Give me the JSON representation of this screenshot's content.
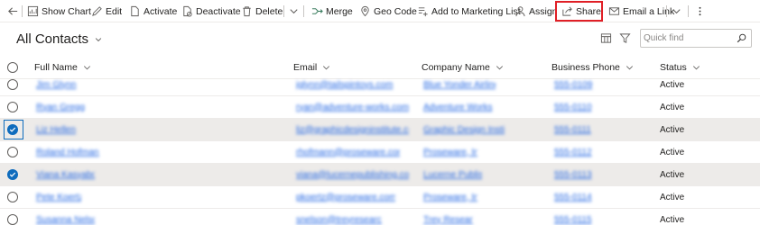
{
  "toolbar": {
    "show_chart": "Show Chart",
    "edit": "Edit",
    "activate": "Activate",
    "deactivate": "Deactivate",
    "delete": "Delete",
    "merge": "Merge",
    "geo_code": "Geo Code",
    "add_to_marketing_list": "Add to Marketing List",
    "assign": "Assign",
    "share": "Share",
    "email_a_link": "Email a Link",
    "highlight_color": "#e01f26"
  },
  "view": {
    "title": "All Contacts",
    "quick_find_placeholder": "Quick find"
  },
  "columns": {
    "full_name": "Full Name",
    "email": "Email",
    "company_name": "Company Name",
    "business_phone": "Business Phone",
    "status": "Status"
  },
  "rows": [
    {
      "name": "Jim Glynn",
      "email": "jglynn@tailspintoys.com",
      "company": "Blue Yonder Airlines",
      "phone": "555-0109",
      "status": "Active",
      "selected": false
    },
    {
      "name": "Ryan Gregg",
      "email": "ryan@adventure-works.com",
      "company": "Adventure Works",
      "phone": "555-0110",
      "status": "Active",
      "selected": false
    },
    {
      "name": "Liz Hellen",
      "email": "liz@graphicdesigninstitute.com",
      "company": "Graphic Design Institute",
      "phone": "555-0111",
      "status": "Active",
      "selected": true
    },
    {
      "name": "Roland Hofmann",
      "email": "rhofmann@proseware.com",
      "company": "Proseware, Inc.",
      "phone": "555-0112",
      "status": "Active",
      "selected": false
    },
    {
      "name": "Viana Kasyabova",
      "email": "viana@lucernepublishing.com",
      "company": "Lucerne Publishing",
      "phone": "555-0113",
      "status": "Active",
      "selected": true
    },
    {
      "name": "Pete Koertz",
      "email": "pkoertz@proseware.com",
      "company": "Proseware, Inc.",
      "phone": "555-0114",
      "status": "Active",
      "selected": false
    },
    {
      "name": "Susanna Nelson",
      "email": "snelson@treyresearch.net",
      "company": "Trey Research",
      "phone": "555-0115",
      "status": "Active",
      "selected": false
    }
  ]
}
